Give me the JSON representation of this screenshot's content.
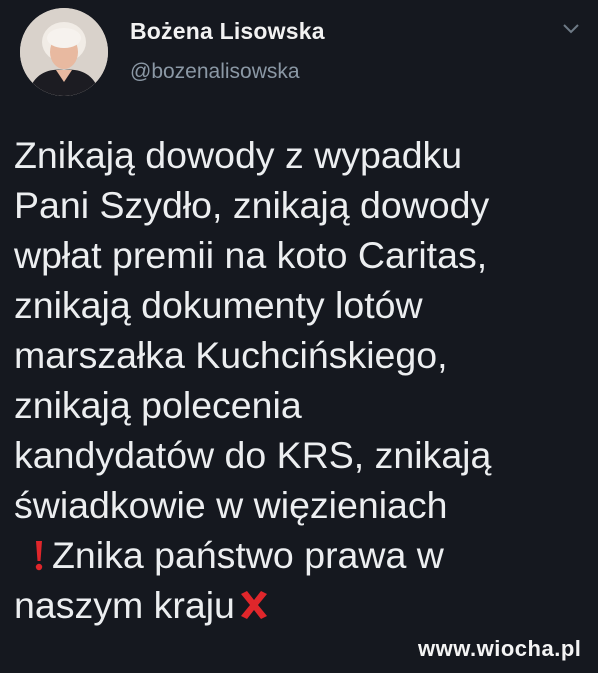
{
  "author": {
    "name": "Bożena Lisowska",
    "handle": "@bozenalisowska",
    "avatar_icon": "profile-photo-icon",
    "menu_icon": "chevron-down-icon"
  },
  "tweet": {
    "lines": [
      "Znikają dowody z wypadku",
      "Pani Szydło, znikają dowody",
      "wpłat premii na koto Caritas,",
      "znikają dokumenty lotów",
      "marszałka Kuchcińskiego,",
      "znikają polecenia",
      "kandydatów do KRS, znikają",
      "świadkowie w więzieniach",
      "Znika państwo prawa w",
      "naszym kraju"
    ],
    "emoji": {
      "exclamation_icon": "red-exclamation-icon",
      "cross_icon": "red-cross-icon",
      "accent_color": "#e0262b"
    }
  },
  "watermark": "www.wiocha.pl",
  "colors": {
    "background": "#15181f",
    "text": "#eceef0",
    "handle": "#8b98a5"
  }
}
